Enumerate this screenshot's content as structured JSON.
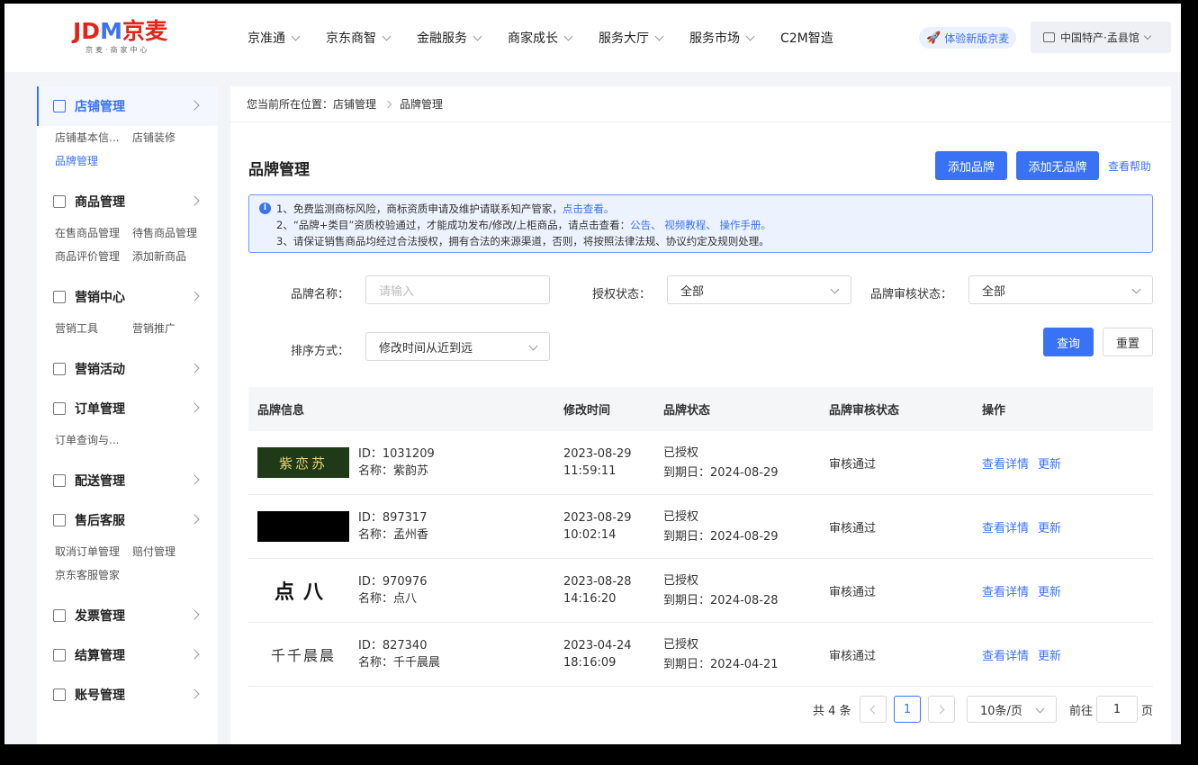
{
  "header": {
    "logo": {
      "j": "JD",
      "m": "M",
      "cn": "京麦",
      "sub": "京麦·商家中心"
    },
    "nav": [
      "京准通",
      "京东商智",
      "金融服务",
      "商家成长",
      "服务大厅",
      "服务市场",
      "C2M智造"
    ],
    "try_new": "体验新版京麦",
    "shop": "中国特产·孟县馆"
  },
  "sidebar": {
    "groups": [
      {
        "title": "店铺管理",
        "icon": "store-icon",
        "active": true,
        "items": [
          "店铺基本信...",
          "店铺装修",
          "品牌管理"
        ],
        "active_item": "品牌管理"
      },
      {
        "title": "商品管理",
        "icon": "bag-icon",
        "items": [
          "在售商品管理",
          "待售商品管理",
          "商品评价管理",
          "添加新商品"
        ]
      },
      {
        "title": "营销中心",
        "icon": "chart-icon",
        "items": [
          "营销工具",
          "营销推广"
        ]
      },
      {
        "title": "营销活动",
        "icon": "grid-icon",
        "items": []
      },
      {
        "title": "订单管理",
        "icon": "order-icon",
        "items": [
          "订单查询与..."
        ]
      },
      {
        "title": "配送管理",
        "icon": "truck-icon",
        "items": []
      },
      {
        "title": "售后客服",
        "icon": "headset-icon",
        "items": [
          "取消订单管理",
          "赔付管理",
          "京东客服管家"
        ]
      },
      {
        "title": "发票管理",
        "icon": "invoice-icon",
        "items": []
      },
      {
        "title": "结算管理",
        "icon": "calculator-icon",
        "items": []
      },
      {
        "title": "账号管理",
        "icon": "user-icon",
        "items": []
      }
    ]
  },
  "breadcrumb": {
    "prefix": "您当前所在位置：",
    "level1": "店铺管理",
    "level2": "品牌管理"
  },
  "page": {
    "title": "品牌管理",
    "add_brand": "添加品牌",
    "add_no_brand": "添加无品牌",
    "help": "查看帮助"
  },
  "notice": {
    "line1": "1、免费监测商标风险，商标资质申请及维护请联系知产管家，",
    "line1_link": "点击查看。",
    "line2": "2、“品牌+类目”资质校验通过，才能成功发布/修改/上柜商品，请点击查看：",
    "line2_links": [
      "公告、",
      "视频教程、",
      "操作手册。"
    ],
    "line3": "3、请保证销售商品均经过合法授权，拥有合法的来源渠道，否则，将按照法律法规、协议约定及规则处理。"
  },
  "filters": {
    "brand_name_label": "品牌名称：",
    "brand_name_placeholder": "请输入",
    "auth_label": "授权状态：",
    "auth_value": "全部",
    "review_label": "品牌审核状态：",
    "review_value": "全部",
    "sort_label": "排序方式：",
    "sort_value": "修改时间从近到远",
    "query": "查询",
    "reset": "重置"
  },
  "table": {
    "headers": [
      "品牌信息",
      "修改时间",
      "品牌状态",
      "品牌审核状态",
      "操作"
    ],
    "rows": [
      {
        "logo_text": "紫恋苏",
        "logo_style": "zls",
        "id": "ID：1031209",
        "name": "名称：紫韵苏",
        "date": "2023-08-29",
        "time": "11:59:11",
        "status": "已授权",
        "expire": "到期日：2024-08-29",
        "review": "审核通过",
        "op1": "查看详情",
        "op2": "更新"
      },
      {
        "logo_text": "",
        "logo_style": "black",
        "id": "ID：897317",
        "name": "名称：孟州香",
        "date": "2023-08-29",
        "time": "10:02:14",
        "status": "已授权",
        "expire": "到期日：2024-08-29",
        "review": "审核通过",
        "op1": "查看详情",
        "op2": "更新"
      },
      {
        "logo_text": "点八",
        "logo_style": "dianba",
        "id": "ID：970976",
        "name": "名称：点八",
        "date": "2023-08-28",
        "time": "14:16:20",
        "status": "已授权",
        "expire": "到期日：2024-08-28",
        "review": "审核通过",
        "op1": "查看详情",
        "op2": "更新"
      },
      {
        "logo_text": "千千晨晨",
        "logo_style": "qq",
        "id": "ID：827340",
        "name": "名称：千千晨晨",
        "date": "2023-04-24",
        "time": "18:16:09",
        "status": "已授权",
        "expire": "到期日：2024-04-21",
        "review": "审核通过",
        "op1": "查看详情",
        "op2": "更新"
      }
    ]
  },
  "pagination": {
    "total": "共 4 条",
    "current": "1",
    "page_size": "10条/页",
    "goto_label": "前往",
    "goto_value": "1",
    "goto_suffix": "页"
  }
}
